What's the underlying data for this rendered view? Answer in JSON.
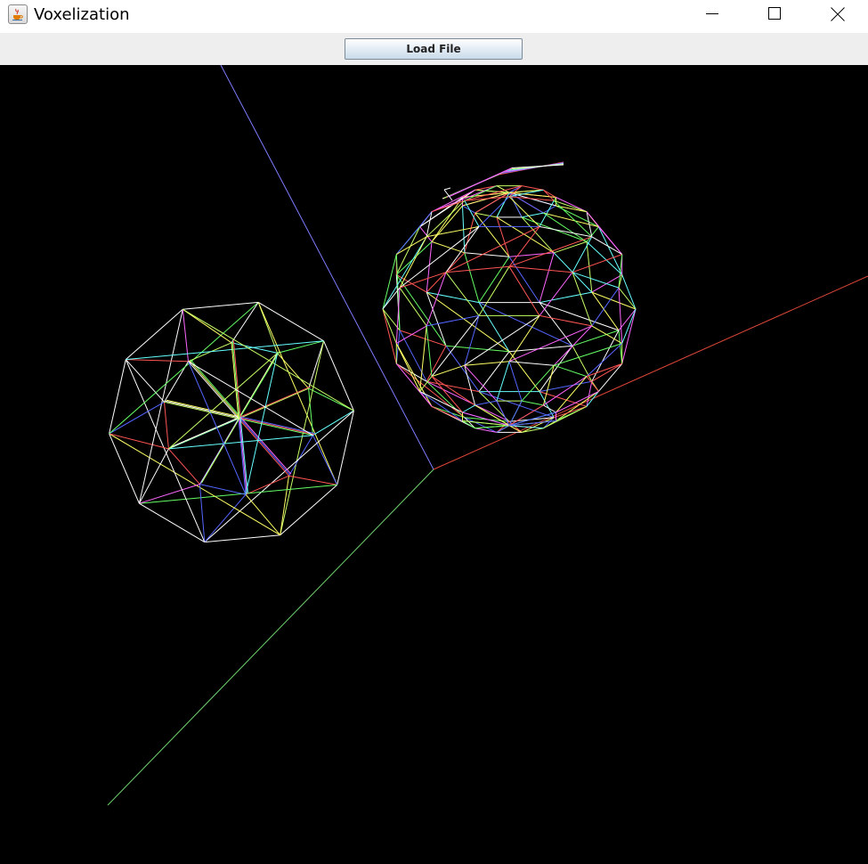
{
  "window": {
    "title": "Voxelization",
    "icon": "java-cup-icon",
    "controls": [
      "minimize-icon",
      "maximize-icon",
      "close-icon"
    ]
  },
  "toolbar": {
    "load_label": "Load File"
  },
  "scene": {
    "background": "#000000",
    "axis_colors": {
      "x": "#e0473a",
      "y": "#6fd26f",
      "z": "#7d7dff"
    },
    "edge_palette": [
      "#ffffff",
      "#ffff66",
      "#66ff66",
      "#ff5555",
      "#5566ff",
      "#ff66ff",
      "#66ffff",
      "#c8ff66"
    ]
  }
}
